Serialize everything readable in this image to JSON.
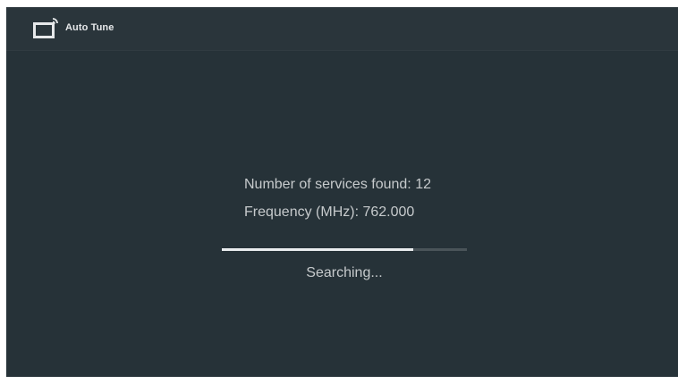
{
  "header": {
    "title": "Auto Tune",
    "icon": "tv-signal-icon"
  },
  "scan": {
    "services_label": "Number of services found: 12",
    "services_count": 12,
    "frequency_label": "Frequency (MHz): 762.000",
    "frequency_mhz": 762.0,
    "progress_fraction": 0.78,
    "status": "Searching..."
  },
  "colors": {
    "background": "#263238",
    "text": "#c6cacc",
    "progress_fill": "#e9ecee",
    "progress_track": "#4a5459"
  }
}
